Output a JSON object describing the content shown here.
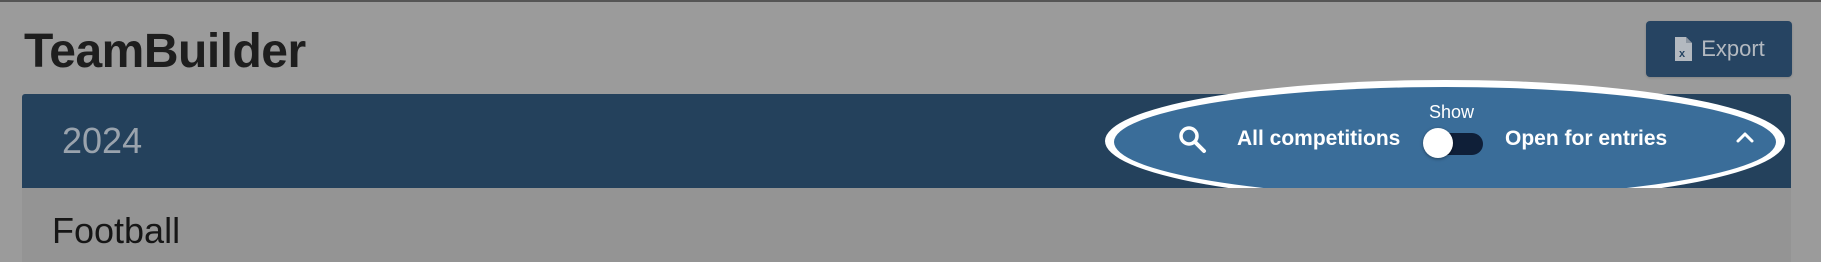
{
  "header": {
    "app_title": "TeamBuilder",
    "export_label": "Export",
    "export_icon": "excel-file-icon"
  },
  "year_bar": {
    "year": "2024",
    "search_icon": "search-icon",
    "filter_left_label": "All competitions",
    "toggle_caption": "Show",
    "toggle_state": "off",
    "filter_right_label": "Open for entries",
    "collapse_icon": "chevron-up-icon"
  },
  "list": {
    "items": [
      {
        "label": "Football"
      }
    ]
  },
  "colors": {
    "page_background": "#9b9b9b",
    "primary_dark": "#24415c",
    "highlight_fill": "#3a6d99",
    "highlight_outline": "#ffffff",
    "toggle_track": "#0f1f38"
  }
}
